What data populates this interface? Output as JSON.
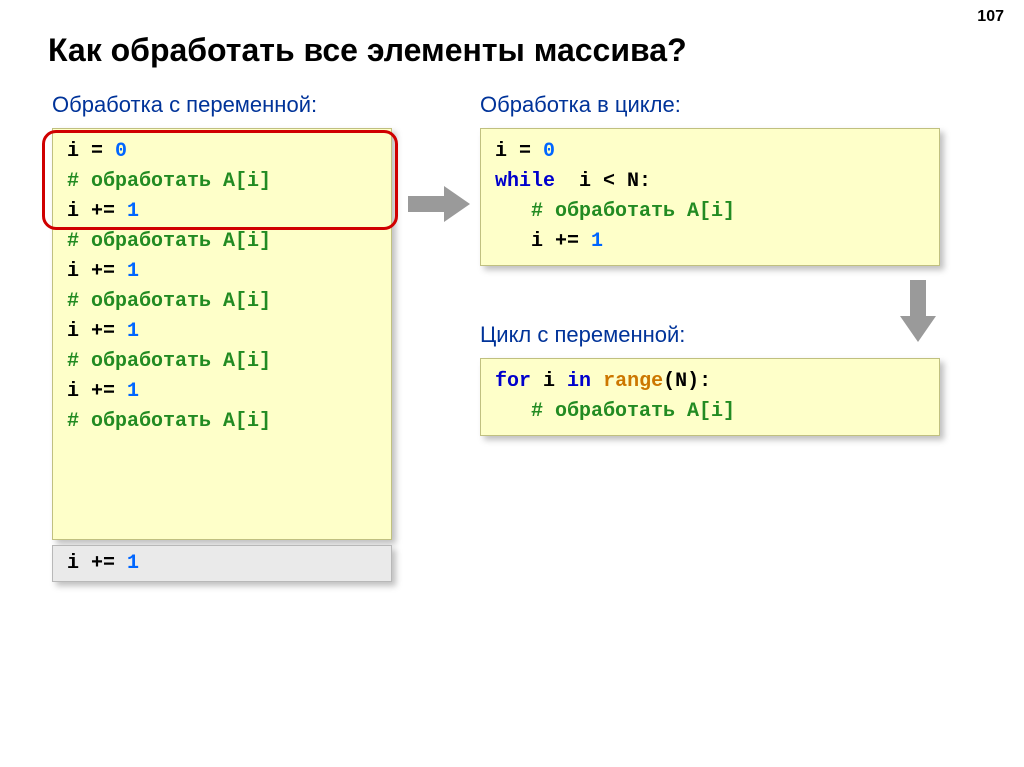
{
  "page_number": "107",
  "title": "Как обработать все элементы массива?",
  "subtitles": {
    "left": "Обработка с переменной:",
    "right": "Обработка в цикле:",
    "bottom": "Цикл с переменной:"
  },
  "code_left": {
    "l1_var": "i = ",
    "l1_num": "0",
    "l2": "# обработать A[i]",
    "l3_var": "i += ",
    "l3_num": "1",
    "l4": "# обработать A[i]",
    "l5_var": "i += ",
    "l5_num": "1",
    "l6": "# обработать A[i]",
    "l7_var": "i += ",
    "l7_num": "1",
    "l8": "# обработать A[i]",
    "l9_var": "i += ",
    "l9_num": "1",
    "l10": "# обработать A[i]"
  },
  "grey_line_var": "i += ",
  "grey_line_num": "1",
  "code_right1": {
    "l1_var": "i = ",
    "l1_num": "0",
    "l2_kw": "while",
    "l2_cond": "  i < N:",
    "l3": "   # обработать A[i]",
    "l4_var": "   i += ",
    "l4_num": "1"
  },
  "code_right2": {
    "l1_for": "for",
    "l1_mid": " i ",
    "l1_in": "in",
    "l1_sp": " ",
    "l1_fn": "range",
    "l1_args": "(N):",
    "l2": "   # обработать A[i]"
  }
}
